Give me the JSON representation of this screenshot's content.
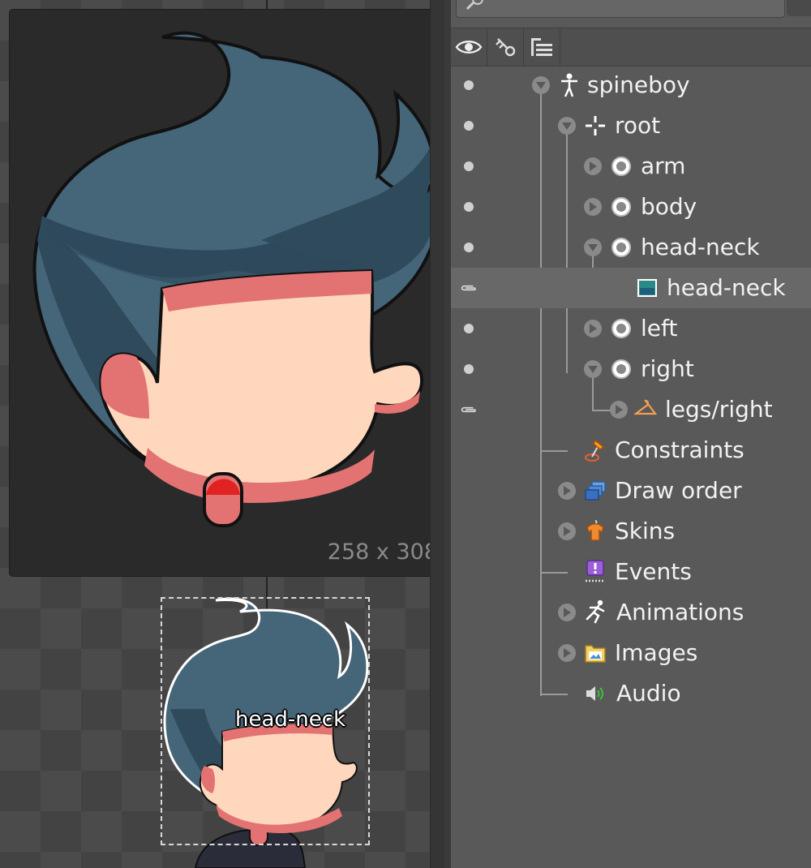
{
  "viewport": {
    "preview_size": "258 x 308",
    "attachment_label": "head-neck"
  },
  "panel": {
    "header_buttons": [
      {
        "icon": "eye-icon"
      },
      {
        "icon": "key-icon"
      },
      {
        "icon": "tree-view-icon"
      }
    ],
    "tree": [
      {
        "label": "spineboy",
        "icon": "skeleton-icon",
        "visibility": "dot"
      },
      {
        "label": "root",
        "icon": "bone-root-icon",
        "visibility": "dot"
      },
      {
        "label": "arm",
        "icon": "bone-icon",
        "visibility": "dot"
      },
      {
        "label": "body",
        "icon": "bone-icon",
        "visibility": "dot"
      },
      {
        "label": "head-neck",
        "icon": "bone-icon",
        "visibility": "dot"
      },
      {
        "label": "head-neck",
        "icon": "region-attachment-icon",
        "visibility": "attachment",
        "selected": true
      },
      {
        "label": "left",
        "icon": "bone-icon",
        "visibility": "dot"
      },
      {
        "label": "right",
        "icon": "bone-icon",
        "visibility": "dot"
      },
      {
        "label": "legs/right",
        "icon": "slot-hanger-icon",
        "visibility": "attachment"
      },
      {
        "label": "Constraints",
        "icon": "constraints-pin-icon"
      },
      {
        "label": "Draw order",
        "icon": "draw-order-icon"
      },
      {
        "label": "Skins",
        "icon": "skins-shirt-icon"
      },
      {
        "label": "Events",
        "icon": "events-icon"
      },
      {
        "label": "Animations",
        "icon": "animations-runner-icon"
      },
      {
        "label": "Images",
        "icon": "images-folder-icon"
      },
      {
        "label": "Audio",
        "icon": "audio-speaker-icon"
      }
    ]
  },
  "colors": {
    "hair": "#456579",
    "hair_dark": "#2e4a5b",
    "skin": "#ffd7bd",
    "skin_shadow": "#e37372",
    "outline": "#111111"
  }
}
